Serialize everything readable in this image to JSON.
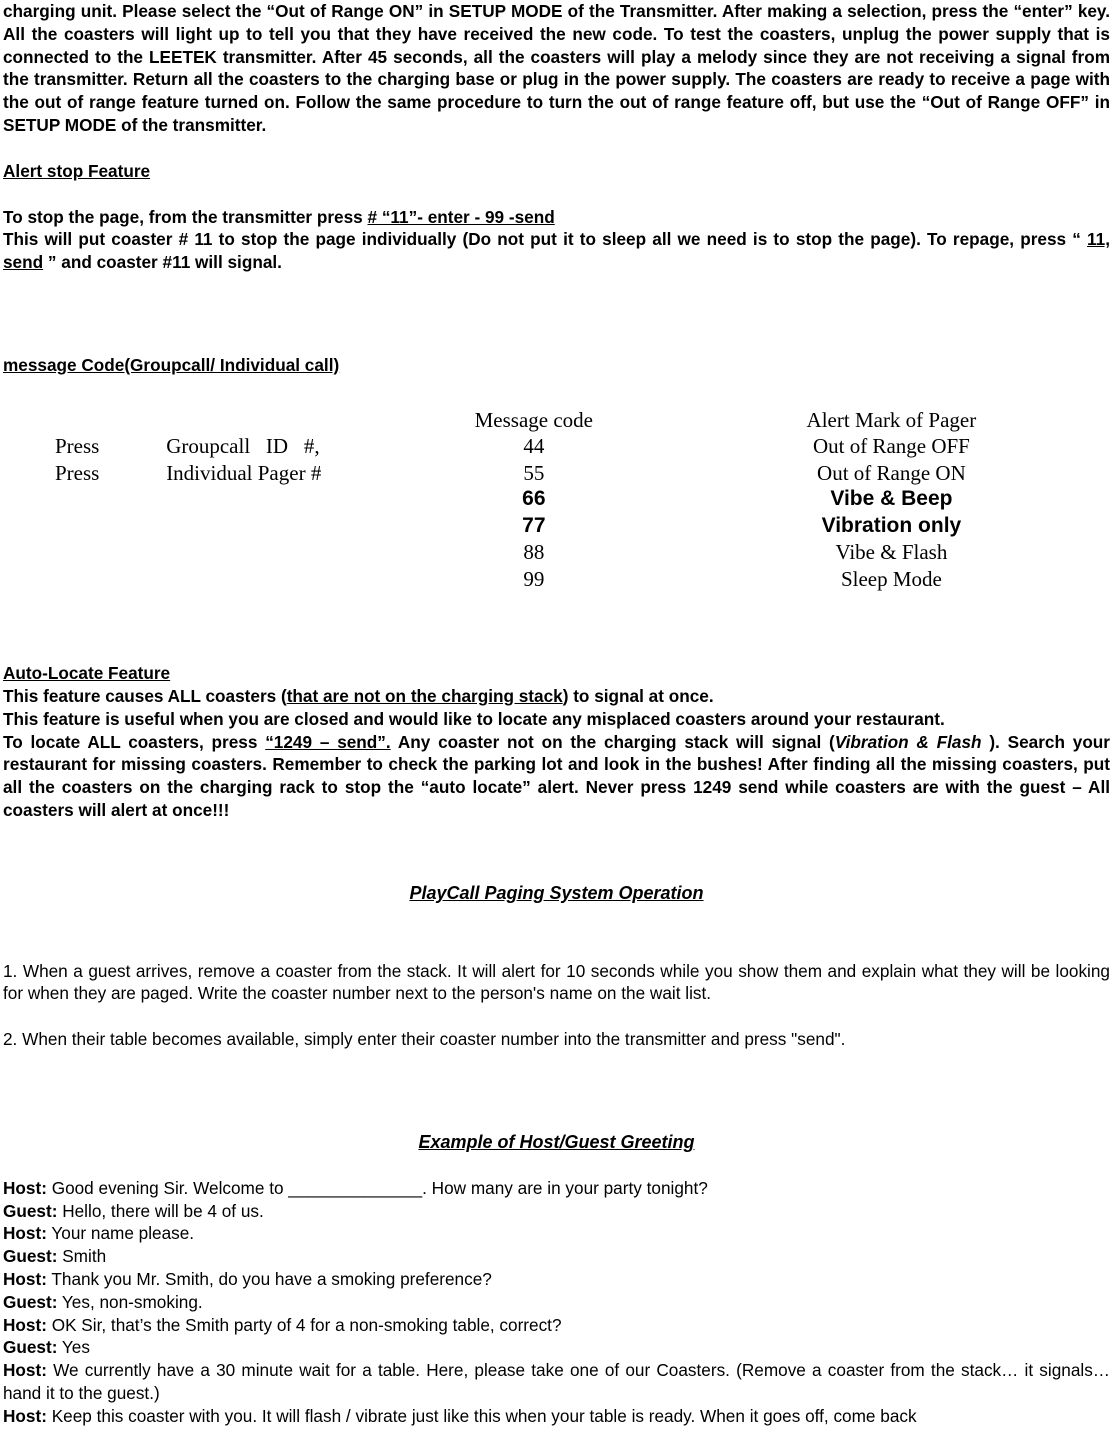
{
  "document": {
    "intro_paragraph": "charging unit. Please select the “Out of Range ON” in SETUP MODE of the Transmitter. After making a selection, press the “enter” key. All the coasters will light up to tell you that they have received the new code. To test the coasters, unplug the power supply that is connected to the LEETEK transmitter. After 45 seconds, all the coasters will play a melody since they are not receiving a signal from the transmitter. Return all the coasters to the charging base or plug in the power supply. The coasters are ready to receive a page with the out of range feature turned on. Follow the same procedure to turn the out of range feature off, but use the “Out of Range OFF” in SETUP MODE of the transmitter."
  },
  "alert_stop": {
    "heading": "Alert stop Feature",
    "line1_prefix": "To stop the page, from the transmitter press ",
    "line1_underlined": "# “11”- enter   - 99 -send",
    "line2": "This will put coaster # 11 to stop the page individually (Do not put it to sleep all we need is to stop the page). To repage, press “ ",
    "line2_underlined": "11, send",
    "line2_suffix": " ” and coaster #11 will signal."
  },
  "message_code": {
    "heading": "message Code(Groupcall/ Individual call)",
    "col_headers": {
      "message_code": "Message code",
      "alert_mark": "Alert Mark of Pager"
    },
    "rows": [
      {
        "press": "Press",
        "target": "Groupcall   ID   #,",
        "code": "44",
        "alert": "Out of Range OFF",
        "style": "serif"
      },
      {
        "press": "Press",
        "target": "Individual Pager #",
        "code": "55",
        "alert": "Out of Range ON",
        "style": "serif"
      },
      {
        "press": "",
        "target": "",
        "code": "66",
        "alert": "Vibe & Beep",
        "style": "sans-bold"
      },
      {
        "press": "",
        "target": "",
        "code": "77",
        "alert": "Vibration only",
        "style": "sans-bold"
      },
      {
        "press": "",
        "target": "",
        "code": "88",
        "alert": "Vibe & Flash",
        "style": "serif"
      },
      {
        "press": "",
        "target": "",
        "code": "99",
        "alert": "Sleep Mode",
        "style": "serif"
      }
    ]
  },
  "auto_locate": {
    "heading": "Auto-Locate Feature",
    "line1_prefix": "This feature causes ALL coasters (",
    "line1_underlined": "that are not on the charging stack",
    "line1_suffix": ") to signal at once.",
    "line2": "This feature is useful when you are closed and would like to locate any misplaced coasters around your restaurant.",
    "body_prefix": "To locate ALL coasters, press ",
    "body_underlined": "“1249 – send”.",
    "body_mid": "  Any coaster not on the charging stack will signal (",
    "body_italic": "Vibration & Flash",
    "body_suffix": " ). Search your restaurant for missing coasters. Remember to check the parking lot and look in the bushes! After finding all the missing coasters, put all the coasters on the charging rack to stop the “auto locate” alert. Never press 1249 send while coasters are with the guest – All coasters will alert at once!!!"
  },
  "operation": {
    "heading": "PlayCall Paging System Operation",
    "step1": "1. When a guest arrives, remove a coaster from the stack.   It will alert for 10 seconds while you show them and explain what they will be looking for when they are paged.    Write the coaster number next to the person's name on the wait list.",
    "step2": "2.    When their table becomes available, simply enter their coaster number into the transmitter and press \"send\"."
  },
  "greeting": {
    "heading": "Example of Host/Guest Greeting",
    "lines": [
      {
        "speaker": "Host:",
        "text": " Good evening Sir.    Welcome to ______________.    How many are in your party tonight?"
      },
      {
        "speaker": "Guest:",
        "text": " Hello, there will be 4 of us."
      },
      {
        "speaker": "Host:",
        "text": " Your name please."
      },
      {
        "speaker": "Guest:",
        "text": " Smith"
      },
      {
        "speaker": "Host:",
        "text": " Thank you Mr. Smith, do you have a smoking preference?"
      },
      {
        "speaker": "Guest:",
        "text": " Yes, non-smoking."
      },
      {
        "speaker": "Host:",
        "text": " OK Sir, that’s the Smith party of 4 for a non-smoking table, correct?"
      },
      {
        "speaker": "Guest:",
        "text": " Yes"
      }
    ],
    "wrapped_lines": [
      {
        "speaker": "Host:",
        "text": " We currently have a 30 minute wait for a table.   Here, please take one of our Coasters.   (Remove a coaster from the stack… it signals… hand it to the guest.)"
      },
      {
        "speaker": "Host:",
        "text": " Keep this coaster with you.    It will flash / vibrate just like this when your table is ready.    When it goes off, come back"
      }
    ]
  }
}
